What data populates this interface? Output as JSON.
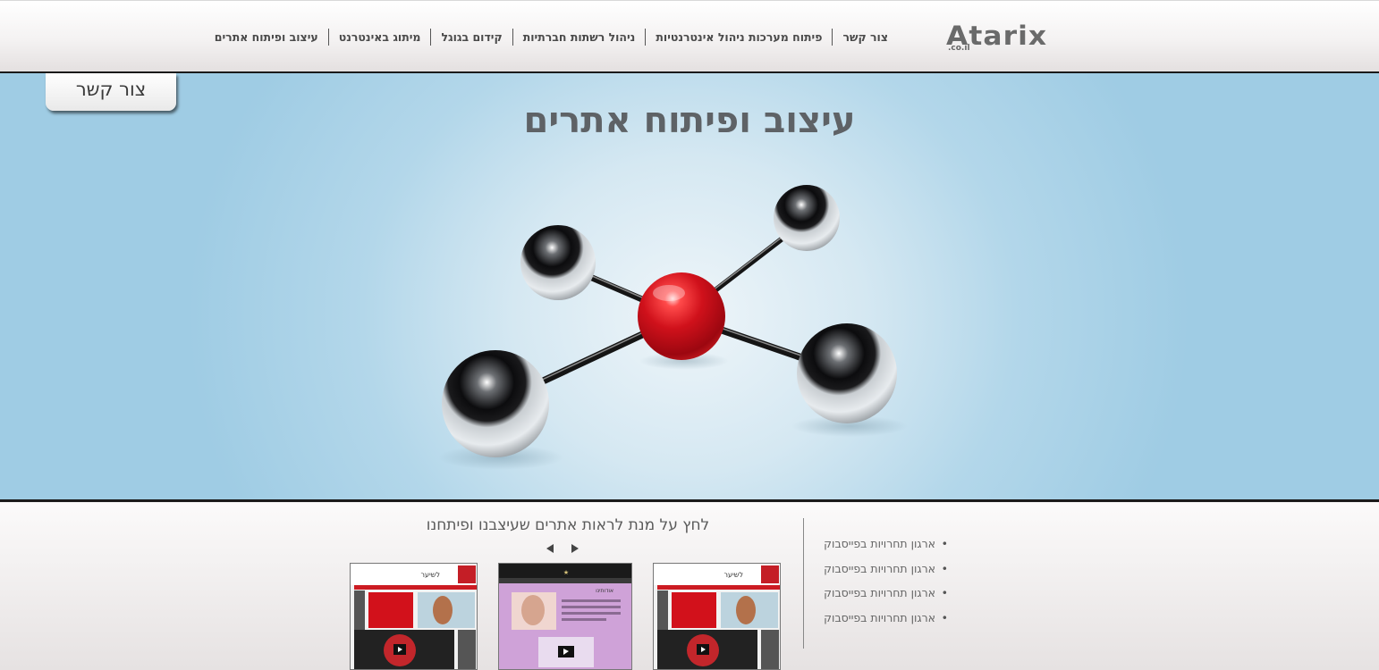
{
  "header": {
    "logo_text": "Atarix",
    "logo_sub": ".co.il",
    "nav": [
      "עיצוב ופיתוח אתרים",
      "מיתוג באינטרנט",
      "קידום בגוגל",
      "ניהול רשתות חברתיות",
      "פיתוח מערכות ניהול אינטרנטיות",
      "צור קשר"
    ]
  },
  "hero": {
    "title": "עיצוב ופיתוח אתרים",
    "contact_tab": "צור קשר"
  },
  "bottom": {
    "bullets": [
      "ארגון תחרויות בפייסבוק",
      "ארגון תחרויות בפייסבוק",
      "ארגון תחרויות בפייסבוק",
      "ארגון תחרויות בפייסבוק"
    ],
    "portfolio_caption": "לחץ על מנת לראות אתרים שעיצבנו ופיתחנו",
    "thumb_left_brand": "לשיער",
    "thumb_center_brand": "אודותינו",
    "thumb_right_brand": "לשיער"
  },
  "colors": {
    "accent_red": "#d0111b",
    "nav_text": "#4a4a4a",
    "hero_sky": "#9fcce4"
  },
  "icons": [
    "prev-arrow-icon",
    "next-arrow-icon"
  ]
}
